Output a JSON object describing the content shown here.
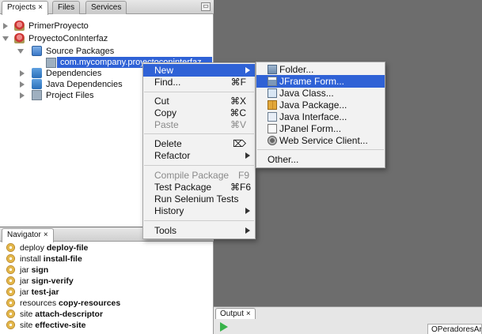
{
  "projects_panel": {
    "tabs": [
      {
        "label": "Projects",
        "close": "×"
      },
      {
        "label": "Files"
      },
      {
        "label": "Services"
      }
    ],
    "tree": [
      {
        "label": "PrimerProyecto"
      },
      {
        "label": "ProyectoConInterfaz"
      },
      {
        "label": "Source Packages"
      },
      {
        "label": "com.mycompany.proy",
        "label_tail": "ectoconinterfaz"
      },
      {
        "label": "Dependencies"
      },
      {
        "label": "Java Dependencies"
      },
      {
        "label": "Project Files"
      }
    ]
  },
  "navigator_panel": {
    "tab": {
      "label": "Navigator",
      "close": "×"
    },
    "items": [
      {
        "prefix": "deploy",
        "name": "deploy-file"
      },
      {
        "prefix": "install",
        "name": "install-file"
      },
      {
        "prefix": "jar",
        "name": "sign"
      },
      {
        "prefix": "jar",
        "name": "sign-verify"
      },
      {
        "prefix": "jar",
        "name": "test-jar"
      },
      {
        "prefix": "resources",
        "name": "copy-resources"
      },
      {
        "prefix": "site",
        "name": "attach-descriptor"
      },
      {
        "prefix": "site",
        "name": "effective-site"
      }
    ]
  },
  "output_panel": {
    "tab": {
      "label": "Output",
      "close": "×"
    },
    "title": "OPeradoresAritm"
  },
  "context_menu": {
    "items": [
      {
        "label": "New",
        "shortcut": "",
        "submenu": true,
        "highlighted": true
      },
      {
        "label": "Find...",
        "shortcut": "⌘F"
      },
      {
        "label": "Cut",
        "shortcut": "⌘X"
      },
      {
        "label": "Copy",
        "shortcut": "⌘C"
      },
      {
        "label": "Paste",
        "shortcut": "⌘V",
        "disabled": true
      },
      {
        "label": "Delete",
        "shortcut": "⌦"
      },
      {
        "label": "Refactor",
        "submenu": true
      },
      {
        "label": "Compile Package",
        "shortcut": "F9",
        "disabled": true
      },
      {
        "label": "Test Package",
        "shortcut": "⌘F6"
      },
      {
        "label": "Run Selenium Tests"
      },
      {
        "label": "History",
        "submenu": true
      },
      {
        "label": "Tools",
        "submenu": true
      }
    ]
  },
  "new_submenu": {
    "items": [
      {
        "label": "Folder...",
        "icon": "folder-icon"
      },
      {
        "label": "JFrame Form...",
        "icon": "jframe-form-icon",
        "highlighted": true
      },
      {
        "label": "Java Class...",
        "icon": "java-class-icon"
      },
      {
        "label": "Java Package...",
        "icon": "java-package-icon"
      },
      {
        "label": "Java Interface...",
        "icon": "java-interface-icon"
      },
      {
        "label": "JPanel Form...",
        "icon": "jpanel-form-icon"
      },
      {
        "label": "Web Service Client...",
        "icon": "web-service-icon"
      },
      {
        "label": "Other..."
      }
    ]
  },
  "colors": {
    "selection": "#2f62d6",
    "workspace": "#6d6d6d"
  }
}
